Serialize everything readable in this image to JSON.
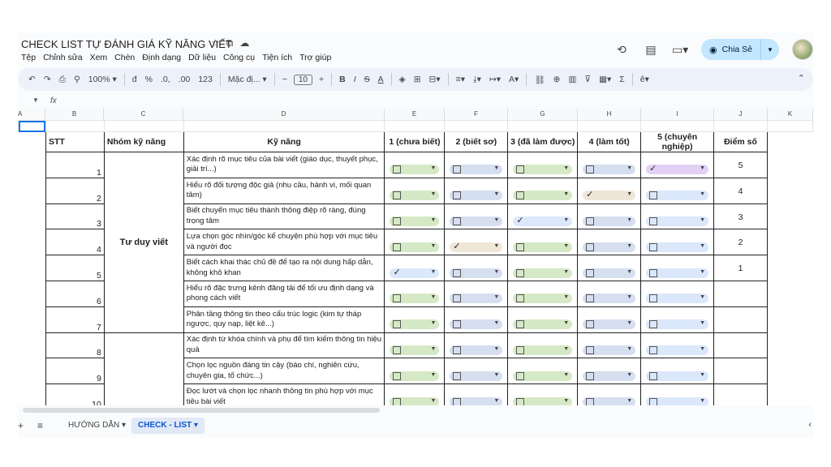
{
  "doc_title": "CHECK LIST TỰ ĐÁNH GIÁ KỸ NĂNG VIẾT",
  "menu": [
    "Tệp",
    "Chỉnh sửa",
    "Xem",
    "Chèn",
    "Định dạng",
    "Dữ liệu",
    "Công cụ",
    "Tiện ích",
    "Trợ giúp"
  ],
  "share_label": "Chia Sẻ",
  "toolbar": {
    "zoom": "100%",
    "currency": "đ",
    "percent": "%",
    "dec_dec": ".0,",
    "inc_dec": ".00",
    "number_format": "123",
    "font_name": "Mặc đị...",
    "font_size": "10"
  },
  "formula": {
    "fx": "fx",
    "value": ""
  },
  "columns": [
    "A",
    "B",
    "C",
    "D",
    "E",
    "F",
    "G",
    "H",
    "I",
    "J",
    "K"
  ],
  "headers": {
    "stt": "STT",
    "nhom": "Nhóm kỹ năng",
    "skill": "Kỹ năng",
    "l1": "1 (chưa biết)",
    "l2": "2 (biết sơ)",
    "l3": "3 (đã làm được)",
    "l4": "4 (làm tốt)",
    "l5": "5 (chuyên nghiệp)",
    "score": "Điểm số"
  },
  "group1": "Tư duy viết",
  "rows": [
    {
      "stt": "1",
      "skill": "Xác định rõ mục tiêu của bài viết (giáo dục, thuyết phục, giải trí...)",
      "checked": 5,
      "score": "5"
    },
    {
      "stt": "2",
      "skill": "Hiểu rõ đối tượng độc giả (nhu cầu, hành vi, mối quan tâm)",
      "checked": 4,
      "score": "4"
    },
    {
      "stt": "3",
      "skill": "Biết chuyển mục tiêu thành thông điệp rõ ràng, đúng trọng tâm",
      "checked": 3,
      "score": "3"
    },
    {
      "stt": "4",
      "skill": "Lựa chọn góc nhìn/góc kể chuyện phù hợp với mục tiêu và người đọc",
      "checked": 2,
      "score": "2"
    },
    {
      "stt": "5",
      "skill": "Biết cách khai thác chủ đề để tạo ra nội dung hấp dẫn, không khô khan",
      "checked": 1,
      "score": "1"
    },
    {
      "stt": "6",
      "skill": "Hiểu rõ đặc trưng kênh đăng tải để tối ưu định dạng và phong cách viết",
      "checked": 0,
      "score": ""
    },
    {
      "stt": "7",
      "skill": "Phân tầng thông tin theo cấu trúc logic (kim tự tháp ngược, quy nạp, liệt kê...)",
      "checked": 0,
      "score": ""
    },
    {
      "stt": "8",
      "skill": "Xác định từ khóa chính và phụ để tìm kiếm thông tin hiệu quả",
      "checked": 0,
      "score": ""
    },
    {
      "stt": "9",
      "skill": "Chọn lọc nguồn đáng tin cậy (báo chí, nghiên cứu, chuyên gia, tổ chức...)",
      "checked": 0,
      "score": ""
    },
    {
      "stt": "10",
      "skill": "Đọc lướt và chọn lọc nhanh thông tin phù hợp với mục tiêu bài viết",
      "checked": 0,
      "score": ""
    }
  ],
  "sheet_tabs": [
    "HƯỚNG DẪN",
    "CHECK - LIST"
  ],
  "colors": {
    "green": "#d6e9c6",
    "blue": "#d5dff0",
    "purple": "#e3d1f5",
    "tan": "#f0e6d8",
    "light_blue": "#dbe7fb",
    "active_tab": "#0b57d0",
    "share_btn": "#c2e7ff"
  },
  "icons": [
    "star-icon",
    "move-folder-icon",
    "cloud-status-icon",
    "history-icon",
    "comment-icon",
    "meet-icon",
    "globe-icon",
    "undo-icon",
    "redo-icon",
    "print-icon",
    "paint-format-icon",
    "bold-icon",
    "italic-icon",
    "strikethrough-icon",
    "text-color-icon",
    "fill-color-icon",
    "borders-icon",
    "merge-icon",
    "align-icon",
    "link-icon",
    "comment-add-icon",
    "chart-icon",
    "filter-icon",
    "sum-icon"
  ]
}
